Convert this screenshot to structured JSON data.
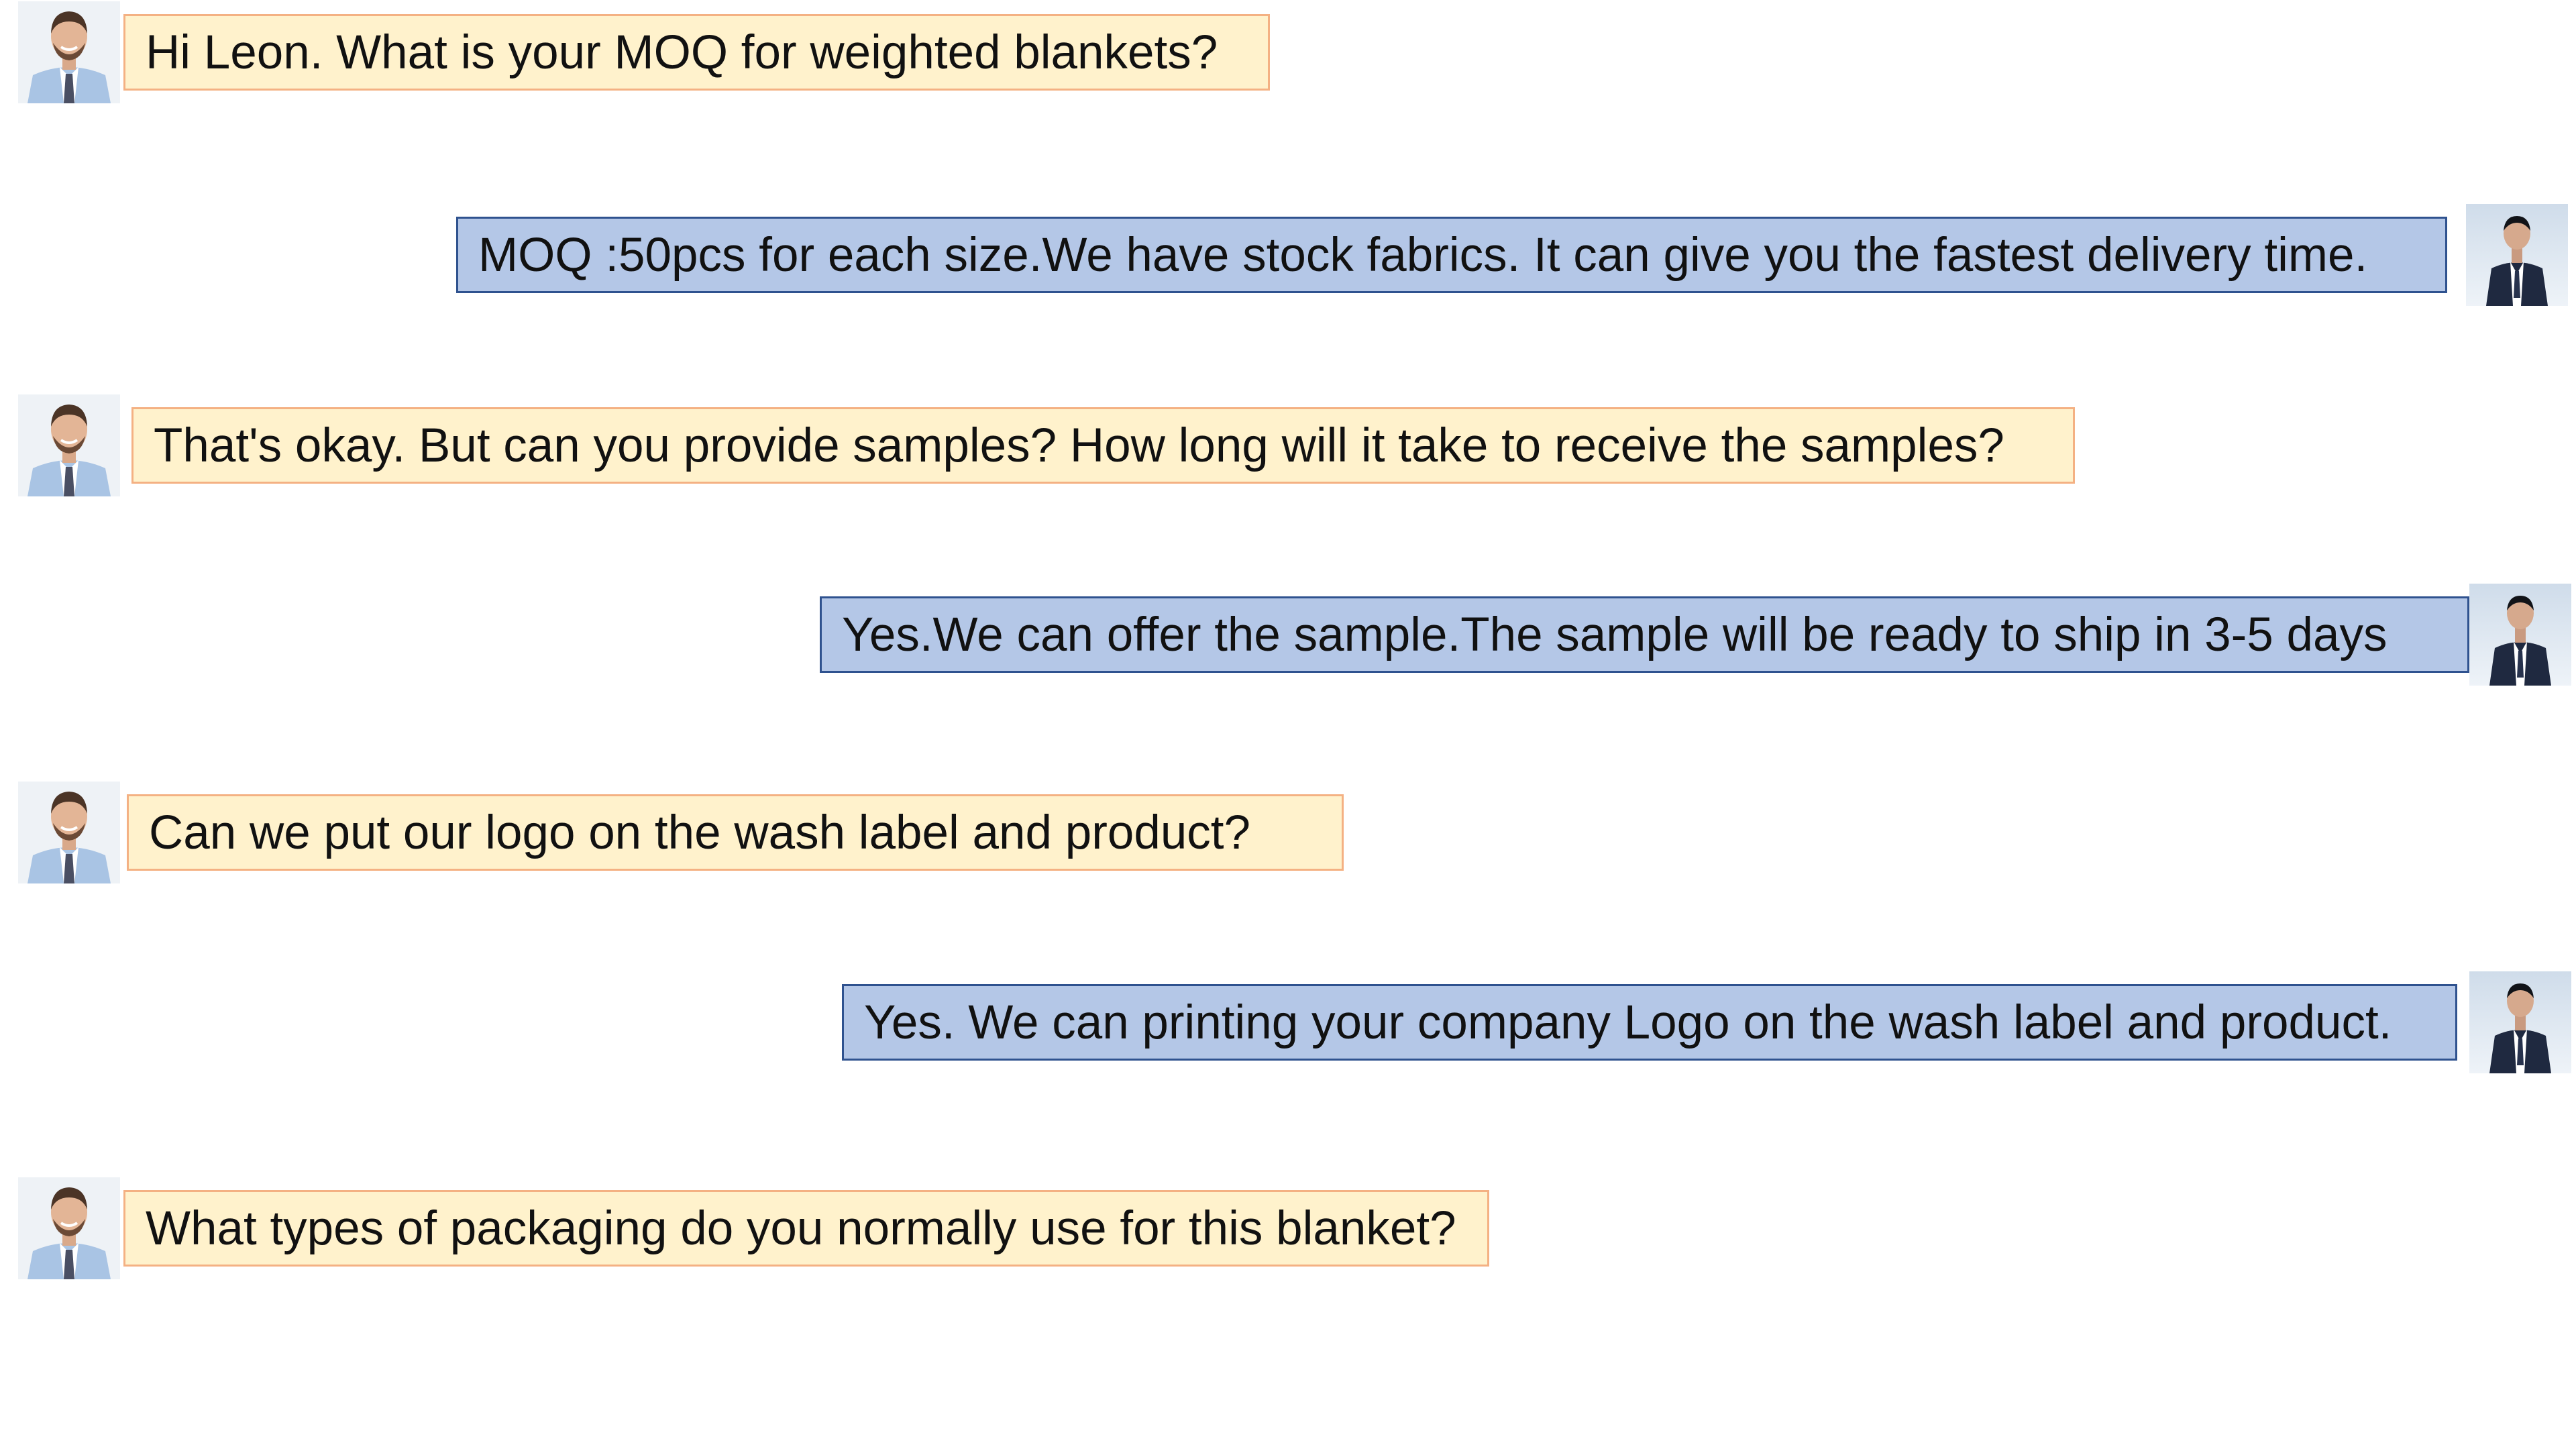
{
  "conversation": {
    "messages": [
      {
        "sender": "customer",
        "avatar_icon": "customer-avatar-icon",
        "text": "Hi Leon. What is your MOQ for weighted blankets?"
      },
      {
        "sender": "seller",
        "avatar_icon": "seller-avatar-icon",
        "text": "MOQ :50pcs for each size.We have stock fabrics. It can give you the fastest delivery time."
      },
      {
        "sender": "customer",
        "avatar_icon": "customer-avatar-icon",
        "text": "That's okay. But can you provide samples? How long will it take to receive the samples?"
      },
      {
        "sender": "seller",
        "avatar_icon": "seller-avatar-icon",
        "text": "Yes.We can offer the sample.The sample will be ready to ship in 3-5 days"
      },
      {
        "sender": "customer",
        "avatar_icon": "customer-avatar-icon",
        "text": "Can we put our logo on the wash label and product?"
      },
      {
        "sender": "seller",
        "avatar_icon": "seller-avatar-icon",
        "text": "Yes. We can printing your company Logo on the wash label and product."
      },
      {
        "sender": "customer",
        "avatar_icon": "customer-avatar-icon",
        "text": "What types of packaging do you normally use for this blanket?"
      }
    ]
  },
  "colors": {
    "customer_bubble_fill": "#fff2cc",
    "customer_bubble_border": "#f4b183",
    "seller_bubble_fill": "#b4c7e7",
    "seller_bubble_border": "#2f528f",
    "text": "#111111"
  }
}
